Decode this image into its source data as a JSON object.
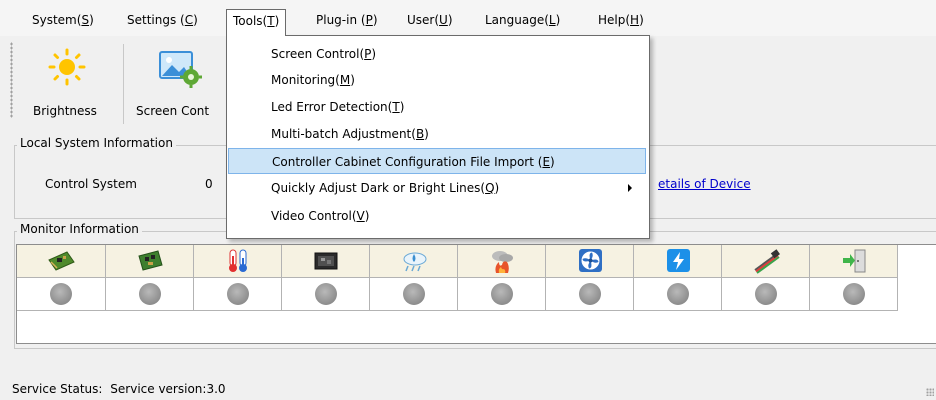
{
  "menubar": {
    "items": [
      {
        "label": "System(",
        "key": "S",
        "suffix": ")"
      },
      {
        "label": "Settings (",
        "key": "C",
        "suffix": ")"
      },
      {
        "label": "Tools(",
        "key": "T",
        "suffix": ")"
      },
      {
        "label": "Plug-in (",
        "key": "P",
        "suffix": ")"
      },
      {
        "label": "User(",
        "key": "U",
        "suffix": ")"
      },
      {
        "label": "Language(",
        "key": "L",
        "suffix": ")"
      },
      {
        "label": "Help(",
        "key": "H",
        "suffix": ")"
      }
    ]
  },
  "toolbar": {
    "brightness_label": "Brightness",
    "screen_control_label": "Screen Cont"
  },
  "tools_menu": {
    "items": [
      {
        "label": "Screen Control(",
        "key": "P",
        "suffix": ")"
      },
      {
        "label": "Monitoring(",
        "key": "M",
        "suffix": ")"
      },
      {
        "label": "Led Error Detection(",
        "key": "T",
        "suffix": ")"
      },
      {
        "label": "Multi-batch Adjustment(",
        "key": "B",
        "suffix": ")"
      },
      {
        "label": "Controller Cabinet Configuration File Import (",
        "key": "E",
        "suffix": ")"
      },
      {
        "label": "Quickly Adjust Dark or Bright Lines(",
        "key": "Q",
        "suffix": ")"
      },
      {
        "label": "Video Control(",
        "key": "V",
        "suffix": ")"
      }
    ]
  },
  "local_system": {
    "title": "Local System Information",
    "control_system_label": "Control System",
    "control_system_value": "0",
    "details_link": "etails of Device"
  },
  "monitor": {
    "title": "Monitor Information",
    "icons": [
      "receiving-card-icon",
      "control-card-icon",
      "temperature-icon",
      "module-icon",
      "humidity-icon",
      "smoke-icon",
      "fan-icon",
      "power-icon",
      "cable-icon",
      "door-icon"
    ]
  },
  "status": {
    "label": "Service Status:",
    "value": "Service version:3.0"
  },
  "colors": {
    "highlight": "#cce4f7",
    "highlight_border": "#7eb4ea",
    "link": "#0000cc",
    "led_off": "#999999",
    "icon_cell_bg": "#f6f2e2"
  }
}
